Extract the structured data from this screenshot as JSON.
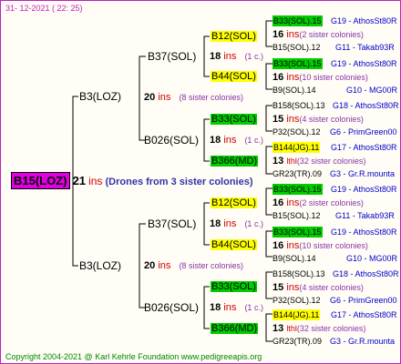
{
  "header": {
    "date": "31- 12-2021 ( 22: 25)"
  },
  "footer": {
    "copyright": "Copyright 2004-2021 @ Karl Kehrle Foundation   www.pedigreeapis.org"
  },
  "root": {
    "label": "B15(LOZ)",
    "gen": "21",
    "ins": "ins",
    "note": "(Drones from 3 sister colonies)"
  },
  "branches": [
    {
      "label": "B3(LOZ)",
      "gen": "20",
      "ins": "ins",
      "note": "(8 sister colonies)",
      "upper": {
        "label": "B37(SOL)",
        "gen": "18",
        "ins": "ins",
        "note": "(1 c.)",
        "a": {
          "label": "B12(SOL)",
          "gen": "16",
          "ins": "ins",
          "note": "(2 sister colonies)",
          "top": {
            "code": "B33(SOL).15",
            "right": "G19 - AthosSt80R"
          },
          "bot": {
            "code": "B15(SOL).12",
            "right": "G11 - Takab93R"
          }
        },
        "b": {
          "label": "B44(SOL)",
          "gen": "16",
          "ins": "ins",
          "note": "(10 sister colonies)",
          "top": {
            "code": "B33(SOL).15",
            "right": "G19 - AthosSt80R"
          },
          "bot": {
            "code": "B9(SOL).14",
            "right": "G10 - MG00R"
          }
        }
      },
      "lower": {
        "label": "B026(SOL)",
        "gen": "18",
        "ins": "ins",
        "note": "(1 c.)",
        "a": {
          "label": "B33(SOL)",
          "gen": "15",
          "ins": "ins",
          "note": "(4 sister colonies)",
          "top": {
            "code": "B158(SOL).13",
            "right": "G18 - AthosSt80R"
          },
          "bot": {
            "code": "P32(SOL).12",
            "right": "G6 - PrimGreen00"
          }
        },
        "b": {
          "label": "B366(MD)",
          "gen": "13",
          "ins": "lthl",
          "note": "(32 sister colonies)",
          "top": {
            "code": "B144(JG).11",
            "right": "G17 - AthosSt80R"
          },
          "bot": {
            "code": "GR23(TR).09",
            "right": "G3 - Gr.R.mounta"
          }
        }
      }
    },
    {
      "label": "B3(LOZ)",
      "gen": "20",
      "ins": "ins",
      "note": "(8 sister colonies)",
      "upper": {
        "label": "B37(SOL)",
        "gen": "18",
        "ins": "ins",
        "note": "(1 c.)",
        "a": {
          "label": "B12(SOL)",
          "gen": "16",
          "ins": "ins",
          "note": "(2 sister colonies)",
          "top": {
            "code": "B33(SOL).15",
            "right": "G19 - AthosSt80R"
          },
          "bot": {
            "code": "B15(SOL).12",
            "right": "G11 - Takab93R"
          }
        },
        "b": {
          "label": "B44(SOL)",
          "gen": "16",
          "ins": "ins",
          "note": "(10 sister colonies)",
          "top": {
            "code": "B33(SOL).15",
            "right": "G19 - AthosSt80R"
          },
          "bot": {
            "code": "B9(SOL).14",
            "right": "G10 - MG00R"
          }
        }
      },
      "lower": {
        "label": "B026(SOL)",
        "gen": "18",
        "ins": "ins",
        "note": "(1 c.)",
        "a": {
          "label": "B33(SOL)",
          "gen": "15",
          "ins": "ins",
          "note": "(4 sister colonies)",
          "top": {
            "code": "B158(SOL).13",
            "right": "G18 - AthosSt80R"
          },
          "bot": {
            "code": "P32(SOL).12",
            "right": "G6 - PrimGreen00"
          }
        },
        "b": {
          "label": "B366(MD)",
          "gen": "13",
          "ins": "lthl",
          "note": "(32 sister colonies)",
          "top": {
            "code": "B144(JG).11",
            "right": "G17 - AthosSt80R"
          },
          "bot": {
            "code": "GR23(TR).09",
            "right": "G3 - Gr.R.mounta"
          }
        }
      }
    }
  ],
  "colors": {
    "yellow": "#ffff00",
    "green": "#00cc00",
    "magenta": "#e000e0",
    "ins": "#d00000",
    "lines": "#000000"
  }
}
